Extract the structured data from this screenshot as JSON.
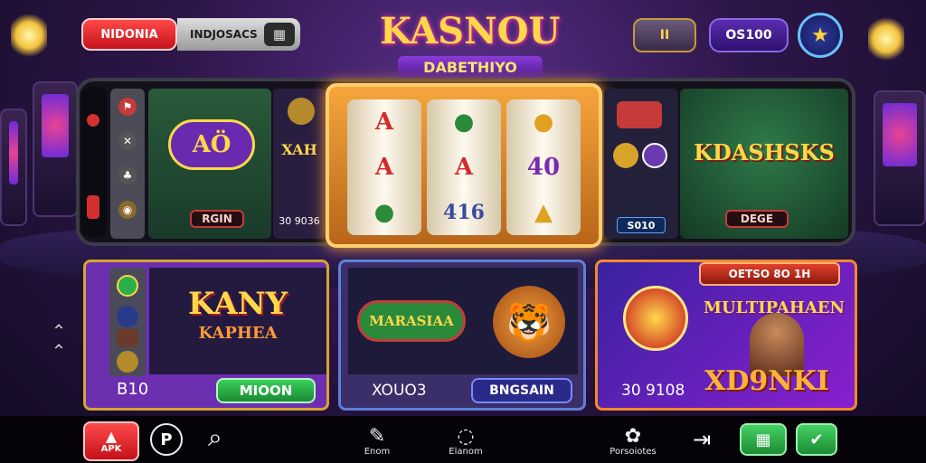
{
  "header": {
    "region_button": "NIDONIA",
    "region_value": "INDJOSACS",
    "calc_icon": "calculator-icon",
    "logo_title": "KASNOU",
    "logo_subtitle": "DABETHIYO",
    "stat_label": "II",
    "balance": "OS100",
    "profile_icon": "star-badge-icon"
  },
  "carousel": {
    "left_game": {
      "badge": "AÖ",
      "button": "RGIN"
    },
    "left_game2": {
      "title": "XAH",
      "value": "30 9036"
    },
    "slot_reels": [
      [
        "A",
        "A",
        "●"
      ],
      [
        "●",
        "A",
        "416"
      ],
      [
        "●",
        "40",
        "▲"
      ]
    ],
    "right_game1": {
      "value": "S010"
    },
    "right_game2": {
      "title": "KDASHSKS",
      "button": "DEGE"
    }
  },
  "side_arrows": [
    "‹",
    "‹"
  ],
  "cards": [
    {
      "title_line1": "KANY",
      "title_line2": "KAPHEA",
      "amount": "B10",
      "action": "MIOON"
    },
    {
      "game_title": "MARASIAA",
      "amount": "XOUO3",
      "action": "BNGSAIN"
    },
    {
      "banner": "OETSO 8O 1H",
      "title": "MULTIPAHAEN",
      "badge": "XD9NKI",
      "amount": "30 9108"
    }
  ],
  "bottom_nav": {
    "apk_label": "APK",
    "p_label": "P",
    "items": [
      {
        "icon": "edit-icon",
        "label": "Enom"
      },
      {
        "icon": "timer-icon",
        "label": "Elanom"
      },
      {
        "icon": "settings-icon",
        "label": "Porsoiotes"
      }
    ]
  },
  "colors": {
    "accent_gold": "#ffd84a",
    "accent_red": "#c4121a",
    "accent_green": "#1c8c34",
    "accent_purple": "#5a2db0"
  }
}
